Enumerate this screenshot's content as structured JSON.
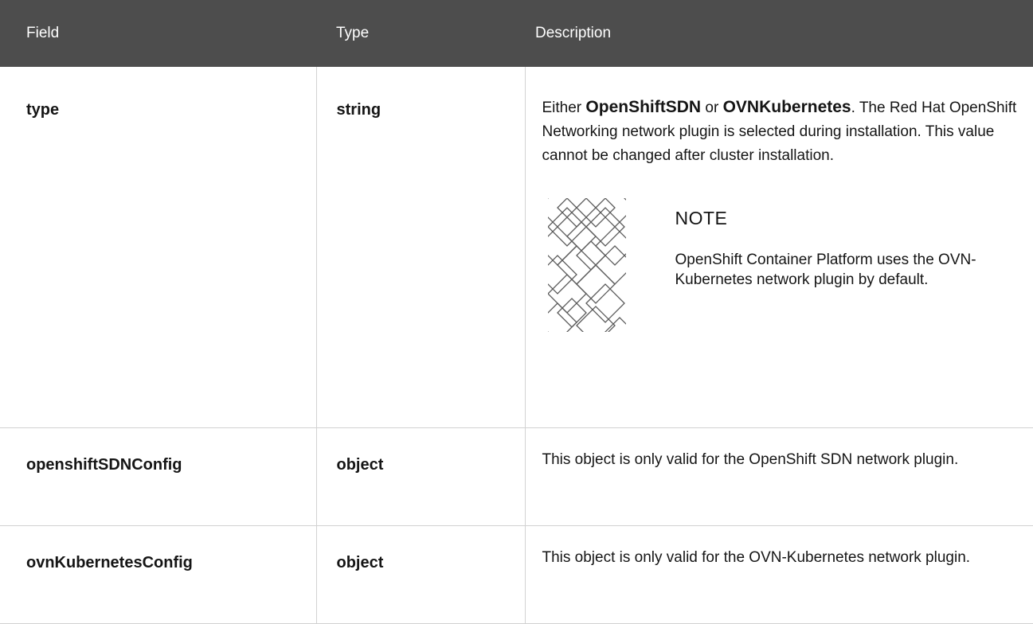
{
  "table": {
    "headers": {
      "field": "Field",
      "type": "Type",
      "description": "Description"
    },
    "rows": [
      {
        "field": "type",
        "type": "string",
        "description": {
          "lead": "Either",
          "option_a": "OpenShiftSDN",
          "joiner": "or",
          "option_b": "OVNKubernetes",
          "rest": ". The Red Hat OpenShift Networking network plugin is selected during installation. This value cannot be changed after cluster installation."
        },
        "note": {
          "icon": "note-pattern-icon",
          "title": "NOTE",
          "text": "OpenShift Container Platform uses the OVN-Kubernetes network plugin by default."
        }
      },
      {
        "field": "openshiftSDNConfig",
        "type": "object",
        "description": "This object is only valid for the OpenShift SDN network plugin."
      },
      {
        "field": "ovnKubernetesConfig",
        "type": "object",
        "description": "This object is only valid for the OVN-Kubernetes network plugin."
      }
    ]
  }
}
